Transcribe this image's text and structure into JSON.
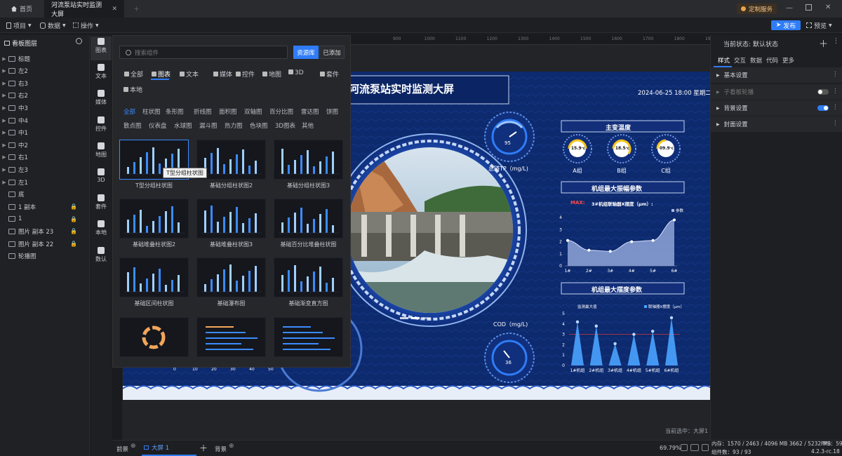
{
  "tabs": [
    {
      "label": "首页",
      "icon": "home-icon"
    },
    {
      "label": "河流泵站实时监测大屏",
      "icon": "close-icon"
    }
  ],
  "top_right": {
    "service_label": "定制服务"
  },
  "toolbar": {
    "project_label": "项目",
    "data_label": "数据",
    "ops_label": "操作",
    "publish_label": "发布",
    "preview_label": "预览"
  },
  "layers": {
    "title": "看板图层",
    "items": [
      {
        "label": "标题",
        "locked": false,
        "group": true
      },
      {
        "label": "左2",
        "locked": false,
        "group": true
      },
      {
        "label": "右3",
        "locked": false,
        "group": true
      },
      {
        "label": "右2",
        "locked": false,
        "group": true
      },
      {
        "label": "中3",
        "locked": false,
        "group": true
      },
      {
        "label": "中4",
        "locked": false,
        "group": true
      },
      {
        "label": "中1",
        "locked": false,
        "group": true
      },
      {
        "label": "中2",
        "locked": false,
        "group": true
      },
      {
        "label": "右1",
        "locked": false,
        "group": true
      },
      {
        "label": "左3",
        "locked": false,
        "group": true
      },
      {
        "label": "左1",
        "locked": false,
        "group": true
      },
      {
        "label": "底",
        "locked": false,
        "group": false
      },
      {
        "label": "1 副本",
        "locked": true,
        "group": false
      },
      {
        "label": "1",
        "locked": true,
        "group": false
      },
      {
        "label": "图片 副本 23",
        "locked": true,
        "group": false
      },
      {
        "label": "图片 副本 22",
        "locked": true,
        "group": false
      },
      {
        "label": "轮播图",
        "locked": false,
        "group": false
      }
    ]
  },
  "rail": [
    {
      "label": "图表",
      "icon": "bar-chart-icon"
    },
    {
      "label": "文本",
      "icon": "text-icon"
    },
    {
      "label": "媒体",
      "icon": "media-icon"
    },
    {
      "label": "控件",
      "icon": "control-icon"
    },
    {
      "label": "地图",
      "icon": "map-icon"
    },
    {
      "label": "3D",
      "icon": "cube-icon"
    },
    {
      "label": "套件",
      "icon": "kit-icon"
    },
    {
      "label": "本地",
      "icon": "puzzle-icon"
    },
    {
      "label": "数认",
      "icon": "data-icon"
    }
  ],
  "components": {
    "search_placeholder": "搜索组件",
    "btn_library": "资源库",
    "btn_added": "已添加",
    "categories": [
      "全部",
      "图表",
      "文本",
      "媒体",
      "控件",
      "地图",
      "3D",
      "套件",
      "本地"
    ],
    "sub_row1": [
      "全部",
      "柱状图",
      "条形图",
      "折线图",
      "面积图",
      "双轴图",
      "百分比图",
      "雷达图",
      "饼图"
    ],
    "sub_row2": [
      "散点图",
      "仪表盘",
      "水球图",
      "漏斗图",
      "热力图",
      "色块图",
      "3D图表",
      "其他"
    ],
    "thumbs": [
      "T型分组柱状图",
      "基础分组柱状图2",
      "基础分组柱状图3",
      "基础堆叠柱状图2",
      "基础堆叠柱状图3",
      "基础百分比堆叠柱状图",
      "基础区间柱状图",
      "基础瀑布图",
      "基础渐变直方图",
      "",
      "",
      ""
    ],
    "tooltip": "T型分组柱状图"
  },
  "dashboard": {
    "title": "河流泵站实时监测大屏",
    "datetime": "2024-06-25 18:00 星期二",
    "gauge_top": {
      "value": "95",
      "label": "总磷TP（mg/L)"
    },
    "gauge_bottom": {
      "value": "36",
      "label": "COD（mg/L)"
    },
    "temp_title": "主变温度",
    "temps": [
      {
        "value": "15.9",
        "unit": "℃",
        "label": "A组"
      },
      {
        "value": "18.5",
        "unit": "℃",
        "label": "B组"
      },
      {
        "value": "09.9",
        "unit": "℃",
        "label": "C组"
      }
    ],
    "amp_title": "机组最大振幅参数",
    "amp_max_label": "MAX:",
    "amp_subtitle": "3#机组联轴器X摆度（μm）:",
    "amp_legend": "参数",
    "swing_title": "机组最大摆度参数",
    "swing_legend_left": "监测最大值",
    "swing_legend_right": "联轴器X摆度（μm）",
    "left_axis_ticks": [
      "0",
      "10",
      "20",
      "30",
      "40",
      "50"
    ],
    "current_selected": "当前选中：大屏1"
  },
  "chart_data": [
    {
      "type": "area",
      "title": "机组最大振幅参数",
      "categories": [
        "1#",
        "2#",
        "3#",
        "4#",
        "5#",
        "6#"
      ],
      "series": [
        {
          "name": "参数",
          "values": [
            2.1,
            1.3,
            1.2,
            2.0,
            2.1,
            3.8
          ]
        }
      ],
      "ylim": [
        0,
        4
      ],
      "yticks": [
        0,
        1,
        2,
        3,
        4
      ]
    },
    {
      "type": "bar",
      "title": "机组最大摆度参数",
      "categories": [
        "1#机组",
        "2#机组",
        "3#机组",
        "4#机组",
        "5#机组",
        "6#机组"
      ],
      "series": [
        {
          "name": "联轴器X摆度（μm）",
          "values": [
            4.2,
            3.8,
            2.1,
            3.0,
            3.3,
            4.6
          ]
        }
      ],
      "reference": 3.0,
      "ylim": [
        0,
        5
      ],
      "yticks": [
        0,
        1,
        2,
        3,
        4,
        5
      ]
    }
  ],
  "ruler_ticks": [
    "900",
    "1000",
    "1100",
    "1200",
    "1300",
    "1400",
    "1500",
    "1600",
    "1700",
    "1800",
    "1900"
  ],
  "right_panel": {
    "state_label": "当前状态:",
    "state_value": "默认状态",
    "tabs": [
      "样式",
      "交互",
      "数据",
      "代码",
      "更多"
    ],
    "sections": [
      {
        "label": "基本设置",
        "toggle": null
      },
      {
        "label": "子看板轮播",
        "toggle": "off"
      },
      {
        "label": "背景设置",
        "toggle": "on"
      },
      {
        "label": "封面设置",
        "toggle": null
      }
    ]
  },
  "bottom": {
    "front_label": "前景",
    "screen_label": "大屏 1",
    "back_label": "背景",
    "zoom": "69.79%",
    "memory": "内存：1570 / 2463 / 4096 MB  3662 / 5232 MB",
    "fps": "FPS：59",
    "component_count": "组件数：93 / 93",
    "version": "4.2.3-rc.18"
  },
  "colors": {
    "accent": "#2f7cf6",
    "screen_bg": "#0d2a6e",
    "yellow": "#f5c518",
    "chart_blue": "#4aa3ff"
  }
}
